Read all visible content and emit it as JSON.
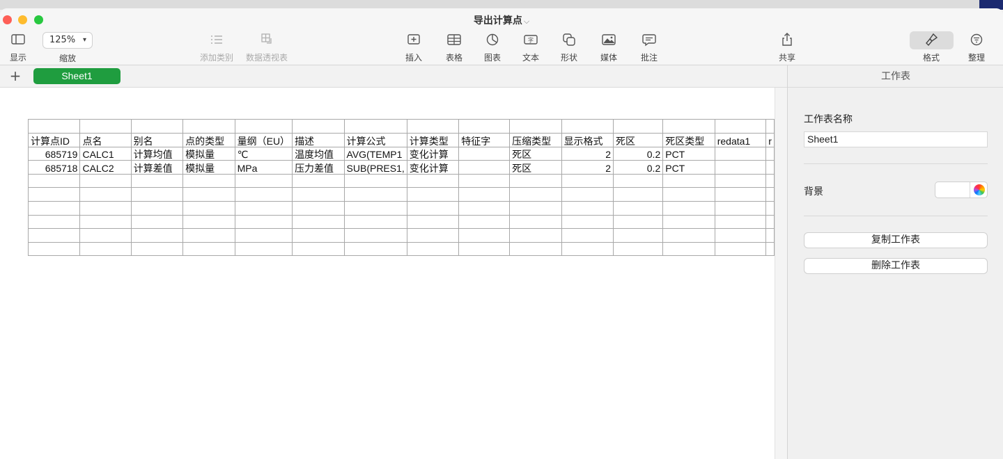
{
  "window": {
    "title": "导出计算点"
  },
  "toolbar": {
    "display_label": "显示",
    "zoom_value": "125%",
    "zoom_label": "缩放",
    "add_category_label": "添加类别",
    "pivot_label": "数据透视表",
    "insert_label": "插入",
    "table_label": "表格",
    "chart_label": "图表",
    "text_label": "文本",
    "shape_label": "形状",
    "media_label": "媒体",
    "comment_label": "批注",
    "share_label": "共享",
    "format_label": "格式",
    "organize_label": "整理"
  },
  "sheets": {
    "add_label": "+",
    "tabs": [
      {
        "label": "Sheet1"
      }
    ]
  },
  "table": {
    "headers": [
      "计算点ID",
      "点名",
      "别名",
      "点的类型",
      "量纲（EU）",
      "描述",
      "计算公式",
      "计算类型",
      "特征字",
      "压缩类型",
      "显示格式",
      "死区",
      "死区类型",
      "redata1",
      "r"
    ],
    "rows": [
      [
        "685719",
        "CALC1",
        "计算均值",
        "模拟量",
        "℃",
        "温度均值",
        "AVG(TEMP1",
        "变化计算",
        "",
        "死区",
        "2",
        "0.2",
        "PCT",
        "",
        ""
      ],
      [
        "685718",
        "CALC2",
        "计算差值",
        "模拟量",
        "MPa",
        "压力差值",
        "SUB(PRES1,",
        "变化计算",
        "",
        "死区",
        "2",
        "0.2",
        "PCT",
        "",
        ""
      ]
    ]
  },
  "panel": {
    "title": "工作表",
    "name_label": "工作表名称",
    "name_value": "Sheet1",
    "background_label": "背景",
    "background_color": "#ffffff",
    "duplicate_label": "复制工作表",
    "delete_label": "删除工作表"
  },
  "colors": {
    "sheet_tab_active": "#1f9d3f",
    "close": "#fe5f57",
    "minimize": "#febc2e",
    "zoom": "#28c840"
  }
}
